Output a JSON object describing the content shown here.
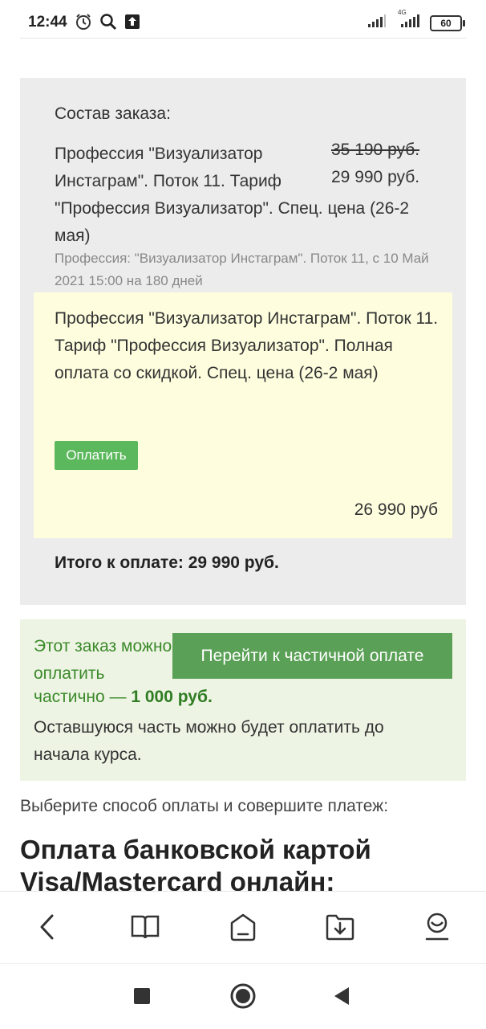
{
  "status_bar": {
    "time": "12:44",
    "network_label": "4G",
    "battery": "60",
    "left_icons": [
      "alarm-icon",
      "search-icon",
      "upload-icon"
    ],
    "right_icons": [
      "signal-icon",
      "signal-4g-icon",
      "battery-icon"
    ]
  },
  "order": {
    "title": "Состав заказа:",
    "product_name": "Профессия \"Визуализатор Инстаграм\". Поток 11. Тариф \"Профессия Визуализатор\". Спец. цена (26-2 мая)",
    "product_name_line1": "Профессия \"Визуализатор",
    "product_name_line2": "Инстаграм\". Поток 11. Тариф",
    "product_name_rest": "\"Профессия Визуализатор\". Спец. цена (26-2 мая)",
    "old_price": "35 190 руб.",
    "new_price": "29 990 руб.",
    "description": "Профессия: \"Визуализатор Инстаграм\". Поток 11, с 10 Май 2021 15:00 на 180 дней",
    "offer": {
      "text": "Профессия \"Визуализатор Инстаграм\". Поток 11. Тариф \"Профессия Визуализатор\". Полная оплата со скидкой. Спец. цена (26-2 мая)",
      "pay_button": "Оплатить",
      "price": "26 990 руб"
    },
    "total": "Итого к оплате: 29 990 руб."
  },
  "partial": {
    "text_start": "Этот заказ можно оплатить",
    "text_line2": "частично — ",
    "amount": "1 000 руб.",
    "rest": "Оставшуюся часть можно будет оплатить до начала курса.",
    "button": "Перейти к частичной оплате"
  },
  "payment": {
    "choose_text": "Выберите способ оплаты и совершите платеж:",
    "card_heading": "Оплата банковской картой Visa/Mastercard онлайн:"
  },
  "browser_nav": [
    "back-icon",
    "book-icon",
    "home-icon",
    "download-icon",
    "profile-icon"
  ],
  "system_nav": [
    "recents-icon",
    "home-circle-icon",
    "back-triangle-icon"
  ],
  "colors": {
    "order_bg": "#ececec",
    "offer_bg": "#fefedf",
    "partial_bg": "#eef4e4",
    "green_button": "#5cb85c",
    "green_text": "#3b8a2a"
  }
}
